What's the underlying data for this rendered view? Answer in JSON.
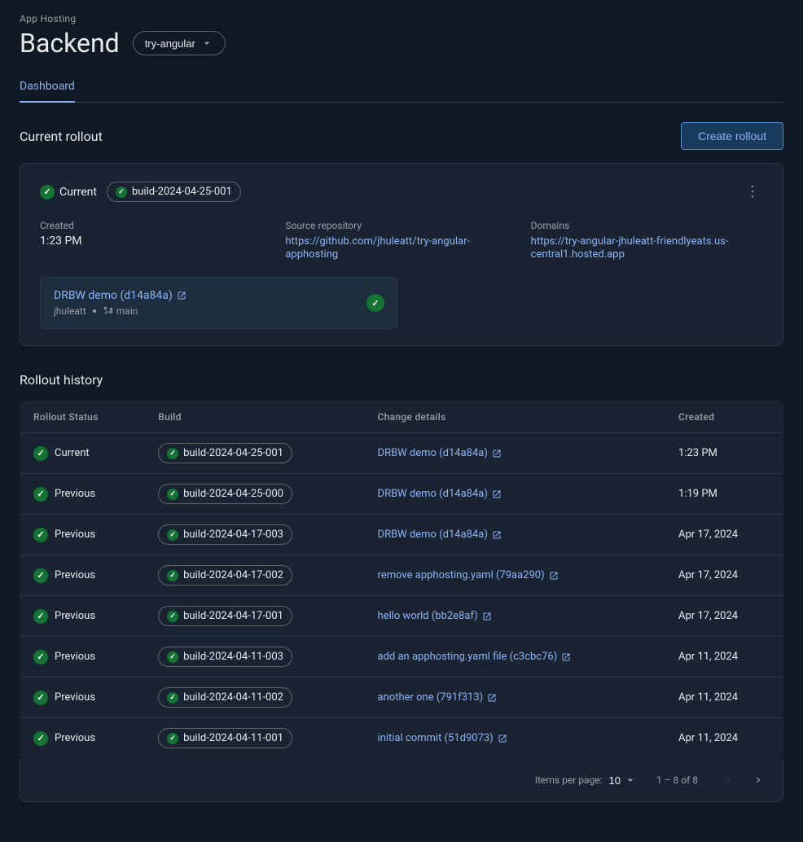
{
  "header": {
    "app_hosting_label": "App Hosting",
    "backend_title": "Backend",
    "branch": "try-angular"
  },
  "tabs": [
    {
      "id": "dashboard",
      "label": "Dashboard",
      "active": true
    }
  ],
  "current_rollout_section": {
    "title": "Current rollout",
    "create_button_label": "Create rollout"
  },
  "current_rollout": {
    "status": "Current",
    "build_id": "build-2024-04-25-001",
    "created_label": "Created",
    "created_value": "1:23 PM",
    "source_repo_label": "Source repository",
    "source_repo_url": "https://github.com/jhuleatt/try-angular-apphosting",
    "source_repo_display": "https://github.com/jhuleatt/try-angular-apphosting",
    "domains_label": "Domains",
    "domains_url": "https://try-angular-jhuleatt-friendlyeats.us-central1.hosted.app",
    "domains_display": "https://try-angular-jhuleatt-friendlyeats.us-central1.hosted.app",
    "commit_link_text": "DRBW demo (d14a84a)",
    "commit_author": "jhuleatt",
    "commit_branch": "main"
  },
  "rollout_history": {
    "title": "Rollout history",
    "columns": [
      "Rollout Status",
      "Build",
      "Change details",
      "Created"
    ],
    "rows": [
      {
        "status": "Current",
        "build": "build-2024-04-25-001",
        "change": "DRBW demo (d14a84a)",
        "created": "1:23 PM"
      },
      {
        "status": "Previous",
        "build": "build-2024-04-25-000",
        "change": "DRBW demo (d14a84a)",
        "created": "1:19 PM"
      },
      {
        "status": "Previous",
        "build": "build-2024-04-17-003",
        "change": "DRBW demo (d14a84a)",
        "created": "Apr 17, 2024"
      },
      {
        "status": "Previous",
        "build": "build-2024-04-17-002",
        "change": "remove apphosting.yaml (79aa290)",
        "created": "Apr 17, 2024"
      },
      {
        "status": "Previous",
        "build": "build-2024-04-17-001",
        "change": "hello world (bb2e8af)",
        "created": "Apr 17, 2024"
      },
      {
        "status": "Previous",
        "build": "build-2024-04-11-003",
        "change": "add an apphosting.yaml file (c3cbc76)",
        "created": "Apr 11, 2024"
      },
      {
        "status": "Previous",
        "build": "build-2024-04-11-002",
        "change": "another one (791f313)",
        "created": "Apr 11, 2024"
      },
      {
        "status": "Previous",
        "build": "build-2024-04-11-001",
        "change": "initial commit (51d9073)",
        "created": "Apr 11, 2024"
      }
    ],
    "items_per_page_label": "Items per page:",
    "items_per_page": "10",
    "pagination_info": "1 – 8 of 8"
  }
}
